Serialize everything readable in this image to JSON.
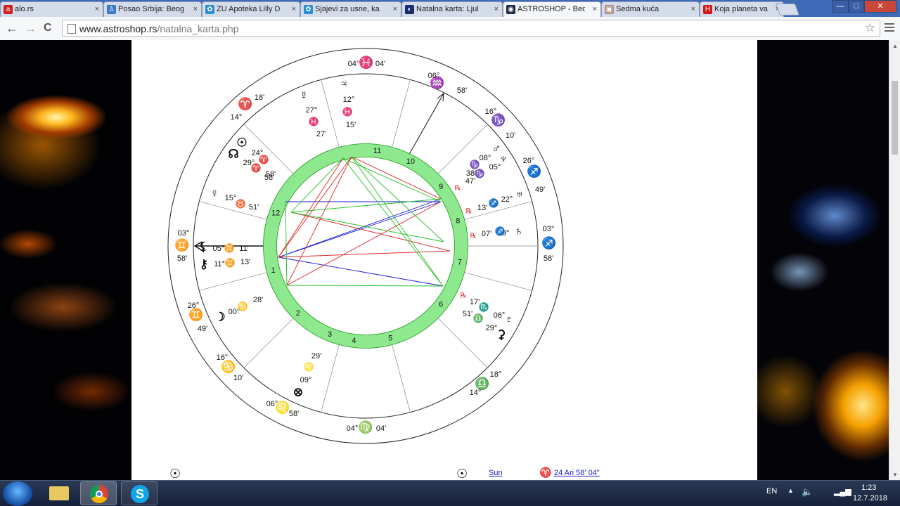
{
  "browser": {
    "tabs": [
      {
        "title": "alo.rs",
        "favicon": "alo-favicon",
        "fav_color": "#d02020",
        "fav_text": "a"
      },
      {
        "title": "Posao Srbija: Beog",
        "favicon": "person-icon",
        "fav_color": "#3a78c8",
        "fav_text": "♙"
      },
      {
        "title": "ZU Apoteka Lilly D",
        "favicon": "pharmacy-icon",
        "fav_color": "#2a8fd0",
        "fav_text": "✿"
      },
      {
        "title": "Sjajevi za usne, ka",
        "favicon": "pharmacy-icon",
        "fav_color": "#2a8fd0",
        "fav_text": "✿"
      },
      {
        "title": "Natalna karta: Ljul",
        "favicon": "astro-icon",
        "fav_color": "#1a2c6a",
        "fav_text": "◐"
      },
      {
        "title": "ASTROSHOP - Beo",
        "favicon": "astroshop-icon",
        "fav_color": "#202a44",
        "fav_text": "◉"
      },
      {
        "title": "Sedma kuća",
        "favicon": "image-icon",
        "fav_color": "#b09080",
        "fav_text": "▣"
      },
      {
        "title": "Koja planeta vam",
        "favicon": "h-icon",
        "fav_color": "#d01818",
        "fav_text": "H"
      }
    ],
    "close_glyph": "×",
    "url_domain": "www.astroshop.rs",
    "url_path": "/natalna_karta.php",
    "nav": {
      "back": "←",
      "forward": "→",
      "reload": "C",
      "star": "☆"
    },
    "window": {
      "min": "—",
      "max": "□",
      "close": "✕"
    }
  },
  "chart": {
    "signs": [
      {
        "glyph": "♓",
        "deg": "04°",
        "min": "04'",
        "color": "#1a1ad0"
      },
      {
        "glyph": "♒",
        "deg": "06°",
        "min": "58'",
        "color": "#e87820"
      },
      {
        "glyph": "♑",
        "deg": "16°",
        "min": "10'",
        "color": "#1a9a1a"
      },
      {
        "glyph": "♐",
        "deg": "26°",
        "min": "49'",
        "color": "#d01818"
      },
      {
        "glyph": "♐",
        "deg": "03°",
        "min": "58'",
        "color": "#d01818"
      },
      {
        "glyph": "♎",
        "deg": "18°",
        "min": "14°",
        "color": "#e87820"
      },
      {
        "glyph": "♍",
        "deg": "04°",
        "min": "04'",
        "color": "#1a9a1a"
      },
      {
        "glyph": "♌",
        "deg": "06°",
        "min": "58'",
        "color": "#d01818"
      },
      {
        "glyph": "♋",
        "deg": "16°",
        "min": "10'",
        "color": "#1a1ad0"
      },
      {
        "glyph": "♊",
        "deg": "26°",
        "min": "49'",
        "color": "#e87820"
      },
      {
        "glyph": "♊",
        "deg": "03°",
        "min": "58'",
        "color": "#e87820"
      },
      {
        "glyph": "♈",
        "deg": "18'",
        "min": "14°",
        "color": "#d01818"
      }
    ],
    "houses": [
      "1",
      "2",
      "3",
      "4",
      "5",
      "6",
      "7",
      "8",
      "9",
      "10",
      "11",
      "12"
    ],
    "planets": [
      {
        "name": "mercury",
        "glyph": "☿",
        "deg": "27°",
        "sign": "♓",
        "min": "27'",
        "sign_color": "#1a1ad0"
      },
      {
        "name": "jupiter",
        "glyph": "♃",
        "deg": "12°",
        "sign": "♓",
        "min": "15'",
        "sign_color": "#1a1ad0"
      },
      {
        "name": "sun",
        "glyph": "☉",
        "deg": "24°",
        "sign": "♈",
        "min": "58'",
        "sign_color": "#d01818"
      },
      {
        "name": "node",
        "glyph": "☊",
        "deg": "29°",
        "sign": "♈",
        "min": "58'",
        "sign_color": "#d01818"
      },
      {
        "name": "venus",
        "glyph": "♀",
        "deg": "15°",
        "sign": "♉",
        "min": "51'",
        "sign_color": "#1a9a1a"
      },
      {
        "name": "asc",
        "glyph": "⚸",
        "deg": "05°",
        "sign": "♊",
        "min": "11'",
        "sign_color": "#e87820"
      },
      {
        "name": "chiron",
        "glyph": "⚷",
        "deg": "11°",
        "sign": "♊",
        "min": "13'",
        "sign_color": "#e87820"
      },
      {
        "name": "moon",
        "glyph": "☽",
        "deg": "00°",
        "sign": "♋",
        "min": "28'",
        "sign_color": "#1a1ad0"
      },
      {
        "name": "fortune",
        "glyph": "⊗",
        "deg": "09°",
        "sign": "♌",
        "min": "29'",
        "sign_color": "#d01818"
      },
      {
        "name": "pluto",
        "glyph": "♇",
        "deg": "06°",
        "sign": "♏",
        "min": "17'",
        "sign_color": "#1a1ad0"
      },
      {
        "name": "lilith",
        "glyph": "⚳",
        "deg": "29°",
        "sign": "♎",
        "min": "51'",
        "sign_color": "#e87820"
      },
      {
        "name": "saturn",
        "glyph": "♄",
        "deg": "09°",
        "sign": "♐",
        "min": "07'",
        "sign_color": "#d01818"
      },
      {
        "name": "uranus",
        "glyph": "♅",
        "deg": "22°",
        "sign": "♐",
        "min": "13'",
        "sign_color": "#d01818"
      },
      {
        "name": "mars",
        "glyph": "♂",
        "deg": "08°",
        "sign": "♑",
        "min": "38'",
        "sign_color": "#1a9a1a"
      },
      {
        "name": "neptune",
        "glyph": "♆",
        "deg": "05°",
        "sign": "♑",
        "min": "47'",
        "sign_color": "#1a9a1a"
      }
    ],
    "retro": "℞",
    "colors": {
      "ring": "#8ee88e",
      "ring_stroke": "#1a9a1a",
      "green": "#20c020",
      "red": "#e02020",
      "blue": "#1818d8"
    }
  },
  "page_bottom": {
    "left_glyph": "☉",
    "right_glyph": "☉",
    "planet_name": "Sun",
    "sign_glyph": "♈",
    "position": "24 Ari 58' 04\""
  },
  "taskbar": {
    "lang": "EN",
    "time": "1:23",
    "date": "12.7.2018"
  }
}
